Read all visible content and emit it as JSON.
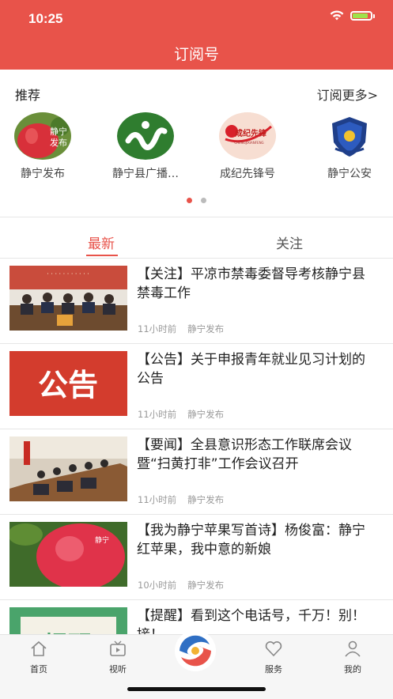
{
  "status": {
    "time": "10:25",
    "battery_level": 0.85
  },
  "header": {
    "title": "订阅号"
  },
  "recommend": {
    "title": "推荐",
    "more": "订阅更多>",
    "items": [
      {
        "name": "静宁发布",
        "icon": "apple-logo"
      },
      {
        "name": "静宁县广播…",
        "icon": "radio-logo"
      },
      {
        "name": "成纪先锋号",
        "icon": "party-logo"
      },
      {
        "name": "静宁公安",
        "icon": "police-badge"
      }
    ],
    "page_count": 2,
    "active_page": 1
  },
  "party_logo": {
    "text": "成纪先锋",
    "sub": "CHENGJIXIANFENG"
  },
  "apple_logo_text": "静宁\n发布",
  "tabs": [
    {
      "label": "最新",
      "active": true
    },
    {
      "label": "关注",
      "active": false
    }
  ],
  "news": [
    {
      "title": "【关注】平凉市禁毒委督导考核静宁县禁毒工作",
      "time": "11小时前",
      "source": "静宁发布",
      "thumb": "meeting-photo"
    },
    {
      "title": "【公告】关于申报青年就业见习计划的公告",
      "time": "11小时前",
      "source": "静宁发布",
      "thumb": "notice-graphic",
      "thumb_text": "公告"
    },
    {
      "title": "【要闻】全县意识形态工作联席会议暨“扫黄打非”工作会议召开",
      "time": "11小时前",
      "source": "静宁发布",
      "thumb": "conference-photo"
    },
    {
      "title": "【我为静宁苹果写首诗】杨俊富：静宁红苹果，我中意的新娘",
      "time": "10小时前",
      "source": "静宁发布",
      "thumb": "apple-photo"
    },
    {
      "title": "【提醒】看到这个电话号，千万！别！接！",
      "time": "",
      "source": "",
      "thumb": "reminder-graphic",
      "thumb_text": "提醒"
    }
  ],
  "tabbar": [
    {
      "label": "首页",
      "icon": "home-icon"
    },
    {
      "label": "视听",
      "icon": "tv-icon"
    },
    {
      "label": "",
      "icon": "app-logo"
    },
    {
      "label": "服务",
      "icon": "heart-icon"
    },
    {
      "label": "我的",
      "icon": "user-icon"
    }
  ],
  "colors": {
    "brand": "#e8534a",
    "meta": "#9a9a9a"
  }
}
